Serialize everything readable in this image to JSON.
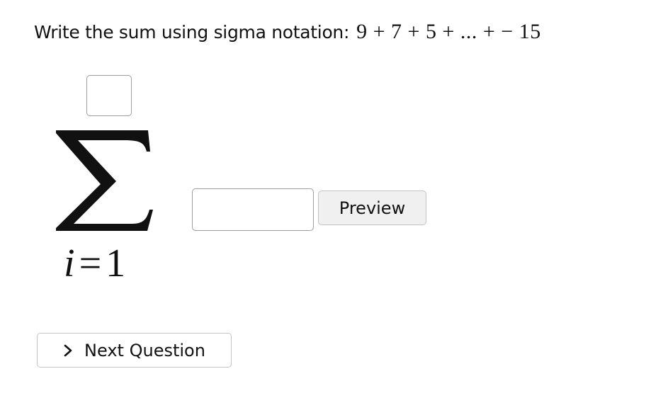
{
  "question": {
    "prompt": "Write the sum using sigma notation:",
    "expression": "9 + 7 + 5 + ... +  − 15"
  },
  "sigma": {
    "upper_limit_value": "",
    "lower_limit_var": "i",
    "lower_limit_eq": "=",
    "lower_limit_value": "1",
    "summand_value": ""
  },
  "buttons": {
    "preview_label": "Preview",
    "next_question_label": "Next Question"
  },
  "icons": {
    "sigma": "sigma-symbol",
    "next": "chevron-right-icon"
  }
}
